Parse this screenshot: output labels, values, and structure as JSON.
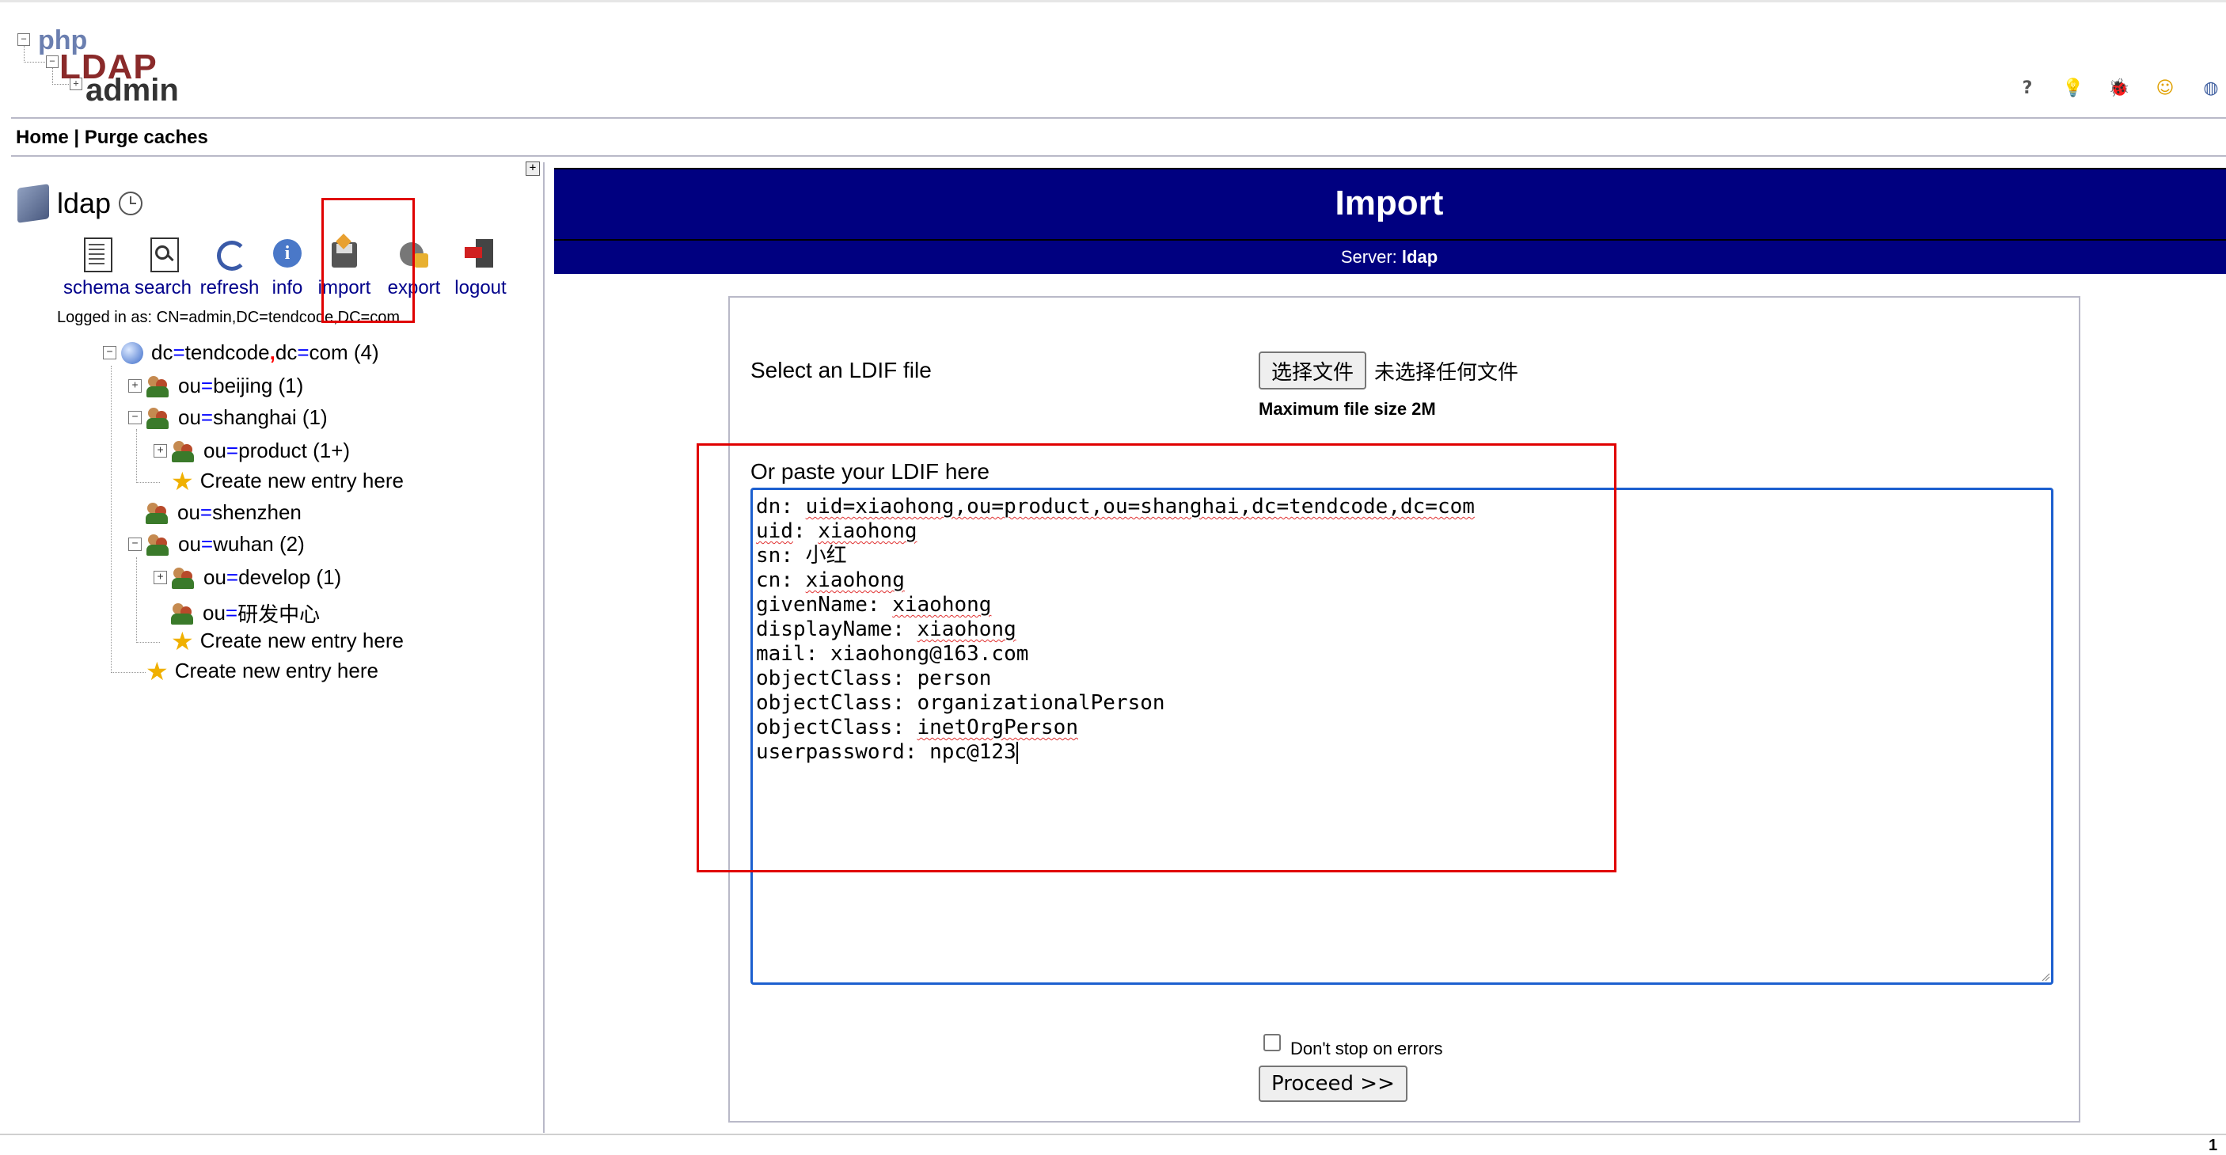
{
  "logo": {
    "php": "php",
    "ldap": "LDAP",
    "admin": "admin"
  },
  "header_icons": [
    {
      "name": "help-icon",
      "glyph": "?",
      "color": "#555"
    },
    {
      "name": "idea-bulb-icon",
      "glyph": "💡",
      "color": "#d8a000"
    },
    {
      "name": "bug-icon",
      "glyph": "🐞",
      "color": "#b00000"
    },
    {
      "name": "smiley-icon",
      "glyph": "☺",
      "color": "#e0a000"
    },
    {
      "name": "globe-icon",
      "glyph": "◍",
      "color": "#4060a0"
    }
  ],
  "menu": {
    "home": "Home",
    "sep": "|",
    "purge": "Purge caches"
  },
  "server": {
    "name": "ldap"
  },
  "toolbar": [
    {
      "id": "schema",
      "label": "schema"
    },
    {
      "id": "search",
      "label": "search"
    },
    {
      "id": "refresh",
      "label": "refresh"
    },
    {
      "id": "info",
      "label": "info"
    },
    {
      "id": "import",
      "label": "import"
    },
    {
      "id": "export",
      "label": "export"
    },
    {
      "id": "logout",
      "label": "logout"
    }
  ],
  "logged_in": "Logged in as: CN=admin,DC=tendcode,DC=com",
  "tree": {
    "root": {
      "k1": "dc",
      "v1": "tendcode",
      "k2": "dc",
      "v2": "com",
      "count": "(4)"
    },
    "beijing": {
      "k": "ou",
      "v": "beijing",
      "count": "(1)"
    },
    "shanghai": {
      "k": "ou",
      "v": "shanghai",
      "count": "(1)"
    },
    "product": {
      "k": "ou",
      "v": "product",
      "count": "(1+)"
    },
    "create1": "Create new entry here",
    "shenzhen": {
      "k": "ou",
      "v": "shenzhen"
    },
    "wuhan": {
      "k": "ou",
      "v": "wuhan",
      "count": "(2)"
    },
    "develop": {
      "k": "ou",
      "v": "develop",
      "count": "(1)"
    },
    "rd": {
      "k": "ou",
      "v": "研发中心"
    },
    "create2": "Create new entry here",
    "create3": "Create new entry here"
  },
  "banner": {
    "title": "Import",
    "server_label": "Server:",
    "server_name": "ldap"
  },
  "form": {
    "select_label": "Select an LDIF file",
    "file_button": "选择文件",
    "no_file": "未选择任何文件",
    "max_size": "Maximum file size 2M",
    "paste_label": "Or paste your LDIF here",
    "ldif_lines": [
      {
        "key": "dn",
        "value": "uid=xiaohong,ou=product,ou=shanghai,dc=tendcode,dc=com"
      },
      {
        "key": "uid",
        "value": "xiaohong"
      },
      {
        "key": "sn",
        "value": "小红"
      },
      {
        "key": "cn",
        "value": "xiaohong"
      },
      {
        "key": "givenName",
        "value": "xiaohong"
      },
      {
        "key": "displayName",
        "value": "xiaohong"
      },
      {
        "key": "mail",
        "value": "xiaohong@163.com"
      },
      {
        "key": "objectClass",
        "value": "person"
      },
      {
        "key": "objectClass",
        "value": "organizationalPerson"
      },
      {
        "key": "objectClass",
        "value": "inetOrgPerson"
      },
      {
        "key": "userpassword",
        "value": "npc@123"
      }
    ],
    "dont_stop_label": "Don't stop on errors",
    "dont_stop_checked": false,
    "proceed": "Proceed >>"
  },
  "page_number": "1"
}
